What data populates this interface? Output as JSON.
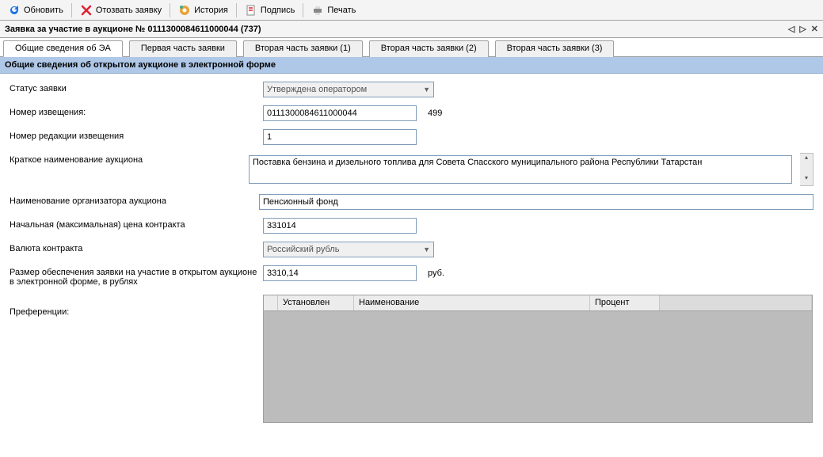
{
  "toolbar": {
    "refresh": "Обновить",
    "withdraw": "Отозвать заявку",
    "history": "История",
    "signature": "Подпись",
    "print": "Печать"
  },
  "window_title": "Заявка за участие в аукционе № 0111300084611000044 (737)",
  "title_ctrls": {
    "prev": "◁",
    "next": "▷",
    "close": "✕"
  },
  "tabs": [
    "Общие сведения об ЭА",
    "Первая часть заявки",
    "Вторая часть заявки (1)",
    "Вторая часть заявки (2)",
    "Вторая часть заявки (3)"
  ],
  "section": "Общие сведения об открытом аукционе в электронной форме",
  "labels": {
    "status": "Статус заявки",
    "notice_no": "Номер извещения:",
    "notice_rev": "Номер редакции извещения",
    "short_name": "Краткое наименование аукциона",
    "organizer": "Наименование организатора аукциона",
    "start_price": "Начальная (максимальная) цена контракта",
    "currency": "Валюта контракта",
    "deposit": "Размер обеспечения заявки на участие в открытом аукционе в электронной форме, в рублях",
    "prefs": "Преференции:"
  },
  "values": {
    "status": "Утверждена оператором",
    "notice_no": "0111300084611000044",
    "notice_no_aux": "499",
    "notice_rev": "1",
    "short_name": "Поставка бензина и дизельного топлива для Совета Спасского муниципального района Республики Татарстан",
    "organizer": "Пенсионный фонд",
    "start_price": "331014",
    "currency": "Российский рубль",
    "deposit": "3310,14",
    "deposit_unit": "руб."
  },
  "grid_headers": [
    "",
    "Установлен",
    "Наименование",
    "Процент"
  ]
}
